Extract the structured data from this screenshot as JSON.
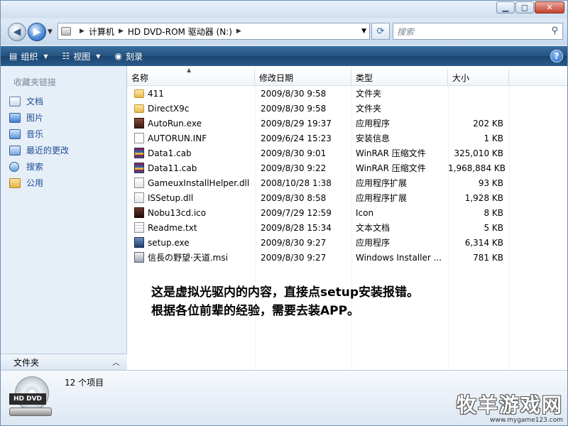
{
  "window": {
    "buttons": {
      "minimize": "▁",
      "maximize": "▢",
      "close": "✕"
    }
  },
  "address": {
    "crumbs": [
      "计算机",
      "HD DVD-ROM 驱动器 (N:)"
    ],
    "search_placeholder": "搜索"
  },
  "toolbar": {
    "organize": "组织",
    "views": "视图",
    "burn": "刻录",
    "help": "?"
  },
  "sidebar": {
    "title": "收藏夹链接",
    "items": [
      {
        "label": "文档",
        "icon": "documents-icon"
      },
      {
        "label": "图片",
        "icon": "pictures-icon"
      },
      {
        "label": "音乐",
        "icon": "music-icon"
      },
      {
        "label": "最近的更改",
        "icon": "recent-changes-icon"
      },
      {
        "label": "搜索",
        "icon": "searches-icon"
      },
      {
        "label": "公用",
        "icon": "public-folder-icon"
      }
    ],
    "folders_label": "文件夹"
  },
  "columns": {
    "name": "名称",
    "date": "修改日期",
    "type": "类型",
    "size": "大小"
  },
  "files": [
    {
      "name": "411",
      "date": "2009/8/30 9:58",
      "type": "文件夹",
      "size": "",
      "icon": "folder"
    },
    {
      "name": "DirectX9c",
      "date": "2009/8/30 9:58",
      "type": "文件夹",
      "size": "",
      "icon": "folder"
    },
    {
      "name": "AutoRun.exe",
      "date": "2009/8/29 19:37",
      "type": "应用程序",
      "size": "202 KB",
      "icon": "exe"
    },
    {
      "name": "AUTORUN.INF",
      "date": "2009/6/24 15:23",
      "type": "安装信息",
      "size": "1 KB",
      "icon": "inf"
    },
    {
      "name": "Data1.cab",
      "date": "2009/8/30 9:01",
      "type": "WinRAR 压缩文件",
      "size": "325,010 KB",
      "icon": "cab"
    },
    {
      "name": "Data11.cab",
      "date": "2009/8/30 9:22",
      "type": "WinRAR 压缩文件",
      "size": "1,968,884 KB",
      "icon": "cab"
    },
    {
      "name": "GameuxInstallHelper.dll",
      "date": "2008/10/28 1:38",
      "type": "应用程序扩展",
      "size": "93 KB",
      "icon": "dll"
    },
    {
      "name": "ISSetup.dll",
      "date": "2009/8/30 8:58",
      "type": "应用程序扩展",
      "size": "1,928 KB",
      "icon": "dll"
    },
    {
      "name": "Nobu13cd.ico",
      "date": "2009/7/29 12:59",
      "type": "Icon",
      "size": "8 KB",
      "icon": "ico"
    },
    {
      "name": "Readme.txt",
      "date": "2009/8/28 15:34",
      "type": "文本文档",
      "size": "5 KB",
      "icon": "txt"
    },
    {
      "name": "setup.exe",
      "date": "2009/8/30 9:27",
      "type": "应用程序",
      "size": "6,314 KB",
      "icon": "setup"
    },
    {
      "name": "信長の野望·天道.msi",
      "date": "2009/8/30 9:27",
      "type": "Windows Installer ...",
      "size": "781 KB",
      "icon": "msi"
    }
  ],
  "annotation": {
    "line1": "这是虚拟光驱内的内容，直接点setup安装报错。",
    "line2": "根据各位前辈的经验，需要去装APP。"
  },
  "details": {
    "drive_label": "HD DVD",
    "count": "12 个项目"
  },
  "watermark": {
    "text": "牧羊游戏网",
    "url": "www.mygame123.com"
  }
}
